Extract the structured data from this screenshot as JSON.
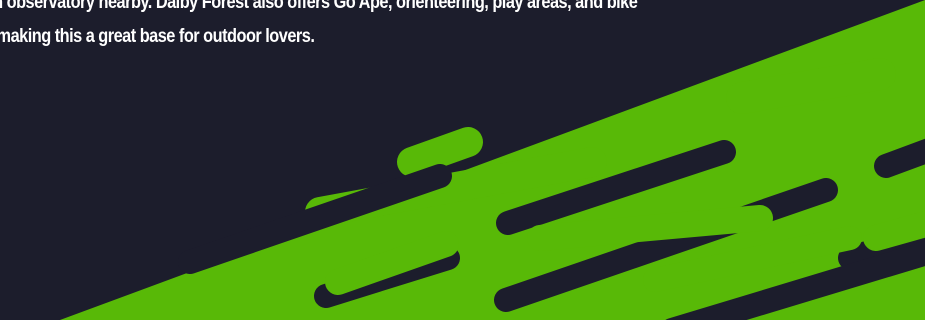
{
  "content": {
    "paragraph_lines": [
      "n observatory nearby. Dalby Forest also offers Go Ape, orienteering, play areas, and bike",
      "making this a great base for outdoor lovers."
    ]
  },
  "colors": {
    "background": "#1c1d2c",
    "text": "#ffffff",
    "stripe_green": "#58b907"
  }
}
